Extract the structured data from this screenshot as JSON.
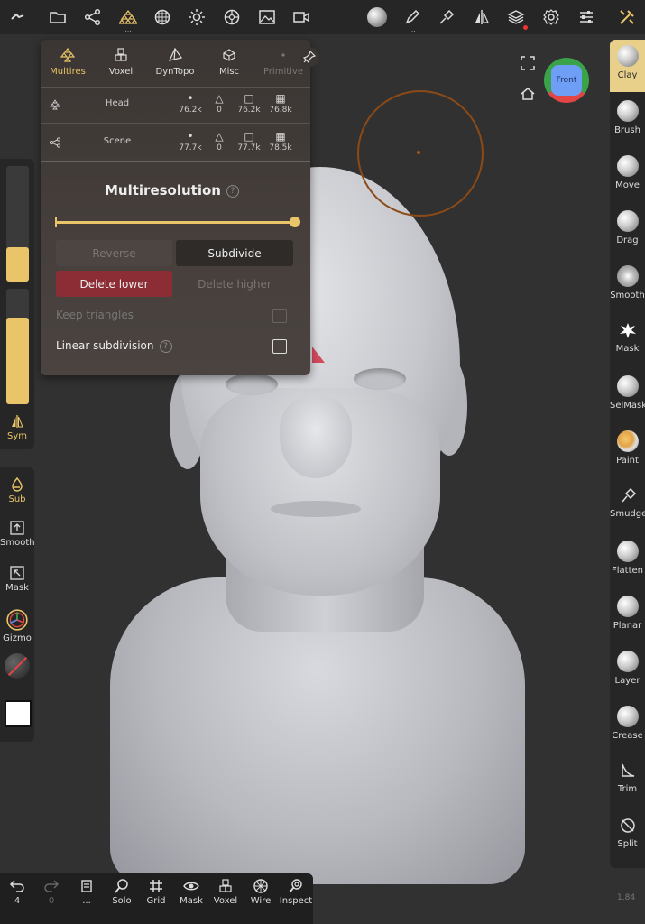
{
  "top_toolbar": {
    "icons": [
      "back-icon",
      "folder-icon",
      "scene-graph-icon",
      "multires-icon",
      "sphere-grid-icon",
      "sun-icon",
      "material-ball-icon",
      "image-icon",
      "camera-icon",
      "material-preview-icon",
      "pen-icon",
      "brush-settings-icon",
      "symmetry-icon",
      "layers-icon",
      "settings-icon",
      "sliders-icon",
      "tools-icon"
    ]
  },
  "panel": {
    "tabs": [
      {
        "label": "Multires",
        "icon": "multires-icon"
      },
      {
        "label": "Voxel",
        "icon": "voxel-icon"
      },
      {
        "label": "DynTopo",
        "icon": "dyntopo-icon"
      },
      {
        "label": "Misc",
        "icon": "misc-icon"
      },
      {
        "label": "Primitive",
        "icon": "primitive-icon"
      }
    ],
    "rows": [
      {
        "name": "Head",
        "vertices": "76.2k",
        "triangles": "0",
        "quads": "76.2k",
        "faces": "76.8k"
      },
      {
        "name": "Scene",
        "vertices": "77.7k",
        "triangles": "0",
        "quads": "77.7k",
        "faces": "78.5k"
      }
    ],
    "title": "Multiresolution",
    "help": "?",
    "slider_value": 1.0,
    "buttons": {
      "reverse": "Reverse",
      "subdivide": "Subdivide",
      "delete_lower": "Delete lower",
      "delete_higher": "Delete higher"
    },
    "options": {
      "keep_triangles": "Keep triangles",
      "linear_subdivision": "Linear subdivision"
    }
  },
  "viewport": {
    "camera_label": "Front"
  },
  "left_panel": {
    "radius_fill": 0.3,
    "intensity_fill": 0.75,
    "sym_label": "Sym"
  },
  "left_tools": [
    {
      "label": "Sub",
      "icon": "drop-icon"
    },
    {
      "label": "Smooth",
      "icon": "smooth-icon"
    },
    {
      "label": "Mask",
      "icon": "mask-icon"
    },
    {
      "label": "Gizmo",
      "icon": "gizmo-icon"
    }
  ],
  "right_tools": [
    {
      "label": "Clay"
    },
    {
      "label": "Brush"
    },
    {
      "label": "Move"
    },
    {
      "label": "Drag"
    },
    {
      "label": "Smooth"
    },
    {
      "label": "Mask"
    },
    {
      "label": "SelMask"
    },
    {
      "label": "Paint"
    },
    {
      "label": "Smudge"
    },
    {
      "label": "Flatten"
    },
    {
      "label": "Planar"
    },
    {
      "label": "Layer"
    },
    {
      "label": "Crease"
    },
    {
      "label": "Trim"
    },
    {
      "label": "Split"
    }
  ],
  "bottom_bar": {
    "undo_count": "4",
    "redo_count": "0",
    "items": [
      {
        "label": "...",
        "icon": "menu-icon"
      },
      {
        "label": "Solo",
        "icon": "solo-icon"
      },
      {
        "label": "Grid",
        "icon": "grid-icon"
      },
      {
        "label": "Mask",
        "icon": "eye-icon"
      },
      {
        "label": "Voxel",
        "icon": "voxel-icon"
      },
      {
        "label": "Wire",
        "icon": "wire-icon"
      },
      {
        "label": "Inspect",
        "icon": "inspect-icon"
      }
    ]
  },
  "version": "1.84",
  "colors": {
    "accent": "#e9c468",
    "danger": "#8c2d35",
    "brush_circle": "#8c4a17"
  }
}
